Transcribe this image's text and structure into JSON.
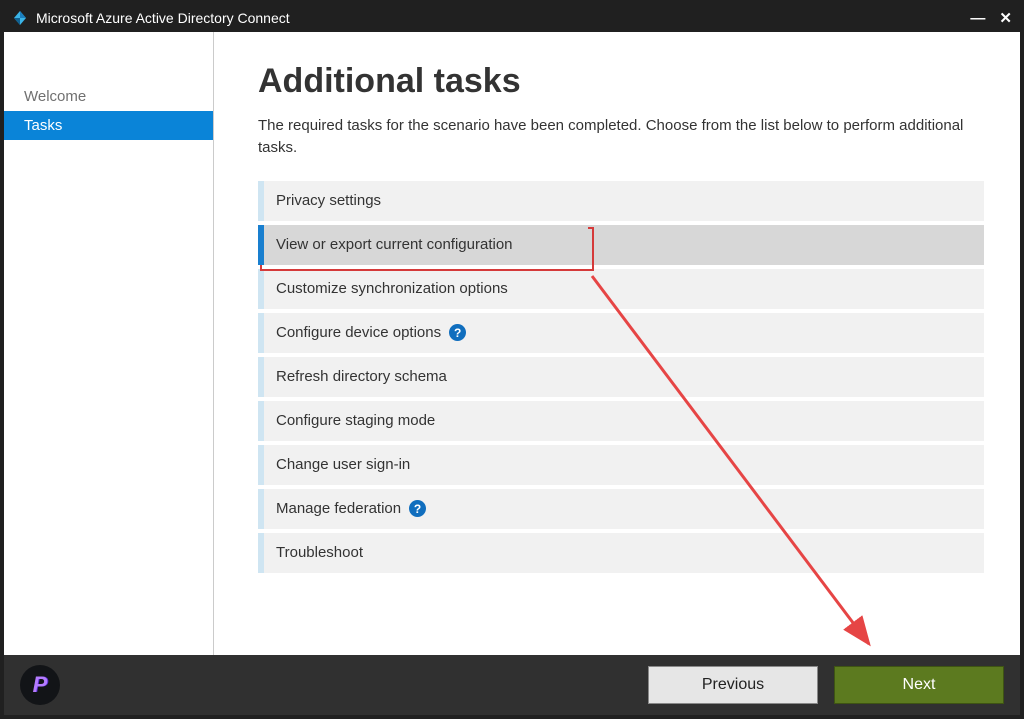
{
  "titlebar": {
    "title": "Microsoft Azure Active Directory Connect"
  },
  "sidebar": {
    "items": [
      {
        "label": "Welcome",
        "active": false
      },
      {
        "label": "Tasks",
        "active": true
      }
    ]
  },
  "main": {
    "heading": "Additional tasks",
    "intro": "The required tasks for the scenario have been completed. Choose from the list below to perform additional tasks.",
    "tasks": [
      {
        "label": "Privacy settings",
        "help": false,
        "selected": false
      },
      {
        "label": "View or export current configuration",
        "help": false,
        "selected": true
      },
      {
        "label": "Customize synchronization options",
        "help": false,
        "selected": false
      },
      {
        "label": "Configure device options",
        "help": true,
        "selected": false
      },
      {
        "label": "Refresh directory schema",
        "help": false,
        "selected": false
      },
      {
        "label": "Configure staging mode",
        "help": false,
        "selected": false
      },
      {
        "label": "Change user sign-in",
        "help": false,
        "selected": false
      },
      {
        "label": "Manage federation",
        "help": true,
        "selected": false
      },
      {
        "label": "Troubleshoot",
        "help": false,
        "selected": false
      }
    ]
  },
  "footer": {
    "brand_letter": "P",
    "previous": "Previous",
    "next": "Next"
  },
  "annotation": {
    "highlight_task_index": 1,
    "arrow": {
      "from_task_index": 1,
      "to": "next_button"
    }
  },
  "colors": {
    "accent_blue": "#0a84d8",
    "next_green": "#5c7a1f",
    "highlight_red": "#d53a3a"
  }
}
